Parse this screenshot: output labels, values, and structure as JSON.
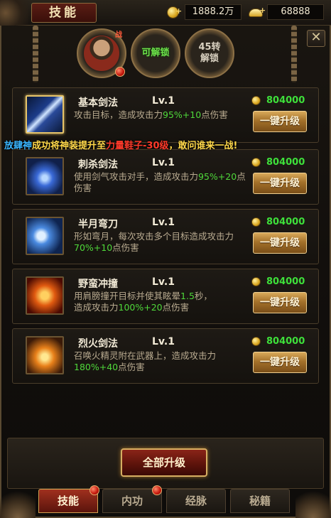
{
  "header": {
    "title": "技能",
    "gold": "1888.2万",
    "ingot": "68888",
    "close_glyph": "✕"
  },
  "characters": [
    {
      "badge": "战",
      "label": "",
      "state": "selected"
    },
    {
      "badge": "",
      "label": "可解锁",
      "state": "unlockable"
    },
    {
      "badge": "",
      "label": "45转\n解锁",
      "state": "locked"
    }
  ],
  "broadcast": {
    "player": "放肆神",
    "text1": "成功将神装提升至",
    "item": "力量鞋子-30级",
    "text2": "，敢问谁来一战!"
  },
  "skills": [
    {
      "name": "基本剑法",
      "level": "Lv.1",
      "cost": "804000",
      "button": "一键升级",
      "desc_pre": "攻击目标，造成攻击力",
      "desc_hl": "95%+10",
      "desc_post": "点伤害",
      "desc_pre2": "",
      "desc_hl2": "",
      "desc_post2": "",
      "icon": "blade-icon"
    },
    {
      "name": "刺杀剑法",
      "level": "Lv.1",
      "cost": "804000",
      "button": "一键升级",
      "desc_pre": "使用剑气攻击对手，造成攻击力",
      "desc_hl": "95%+20",
      "desc_post": "点伤害",
      "desc_pre2": "",
      "desc_hl2": "",
      "desc_post2": "",
      "icon": "sword-qi-icon"
    },
    {
      "name": "半月弯刀",
      "level": "Lv.1",
      "cost": "804000",
      "button": "一键升级",
      "desc_pre": "形如弯月，每次攻击多个目标造成攻击力",
      "desc_hl": "70%+10",
      "desc_post": "点伤害",
      "desc_pre2": "",
      "desc_hl2": "",
      "desc_post2": "",
      "icon": "crescent-icon"
    },
    {
      "name": "野蛮冲撞",
      "level": "Lv.1",
      "cost": "804000",
      "button": "一键升级",
      "desc_pre": "用肩膀撞开目标并使其眩晕",
      "desc_hl": "1.5",
      "desc_post": "秒，",
      "desc_pre2": "造成攻击力",
      "desc_hl2": "100%+20",
      "desc_post2": "点伤害",
      "icon": "charge-icon"
    },
    {
      "name": "烈火剑法",
      "level": "Lv.1",
      "cost": "804000",
      "button": "一键升级",
      "desc_pre": "召唤火精灵附在武器上，造成攻击力",
      "desc_hl": "180%+40",
      "desc_post": "点伤害",
      "desc_pre2": "",
      "desc_hl2": "",
      "desc_post2": "",
      "icon": "fire-sword-icon"
    }
  ],
  "footer": {
    "all_upgrade": "全部升级"
  },
  "tabs": [
    {
      "label": "技能",
      "active": true,
      "dot": true
    },
    {
      "label": "内功",
      "active": false,
      "dot": true
    },
    {
      "label": "经脉",
      "active": false,
      "dot": false
    },
    {
      "label": "秘籍",
      "active": false,
      "dot": false
    }
  ],
  "colors": {
    "highlight_green": "#4fd83a",
    "broadcast_name": "#3ab6ff",
    "broadcast_text": "#ffd84a",
    "broadcast_item": "#ff3a2a"
  }
}
